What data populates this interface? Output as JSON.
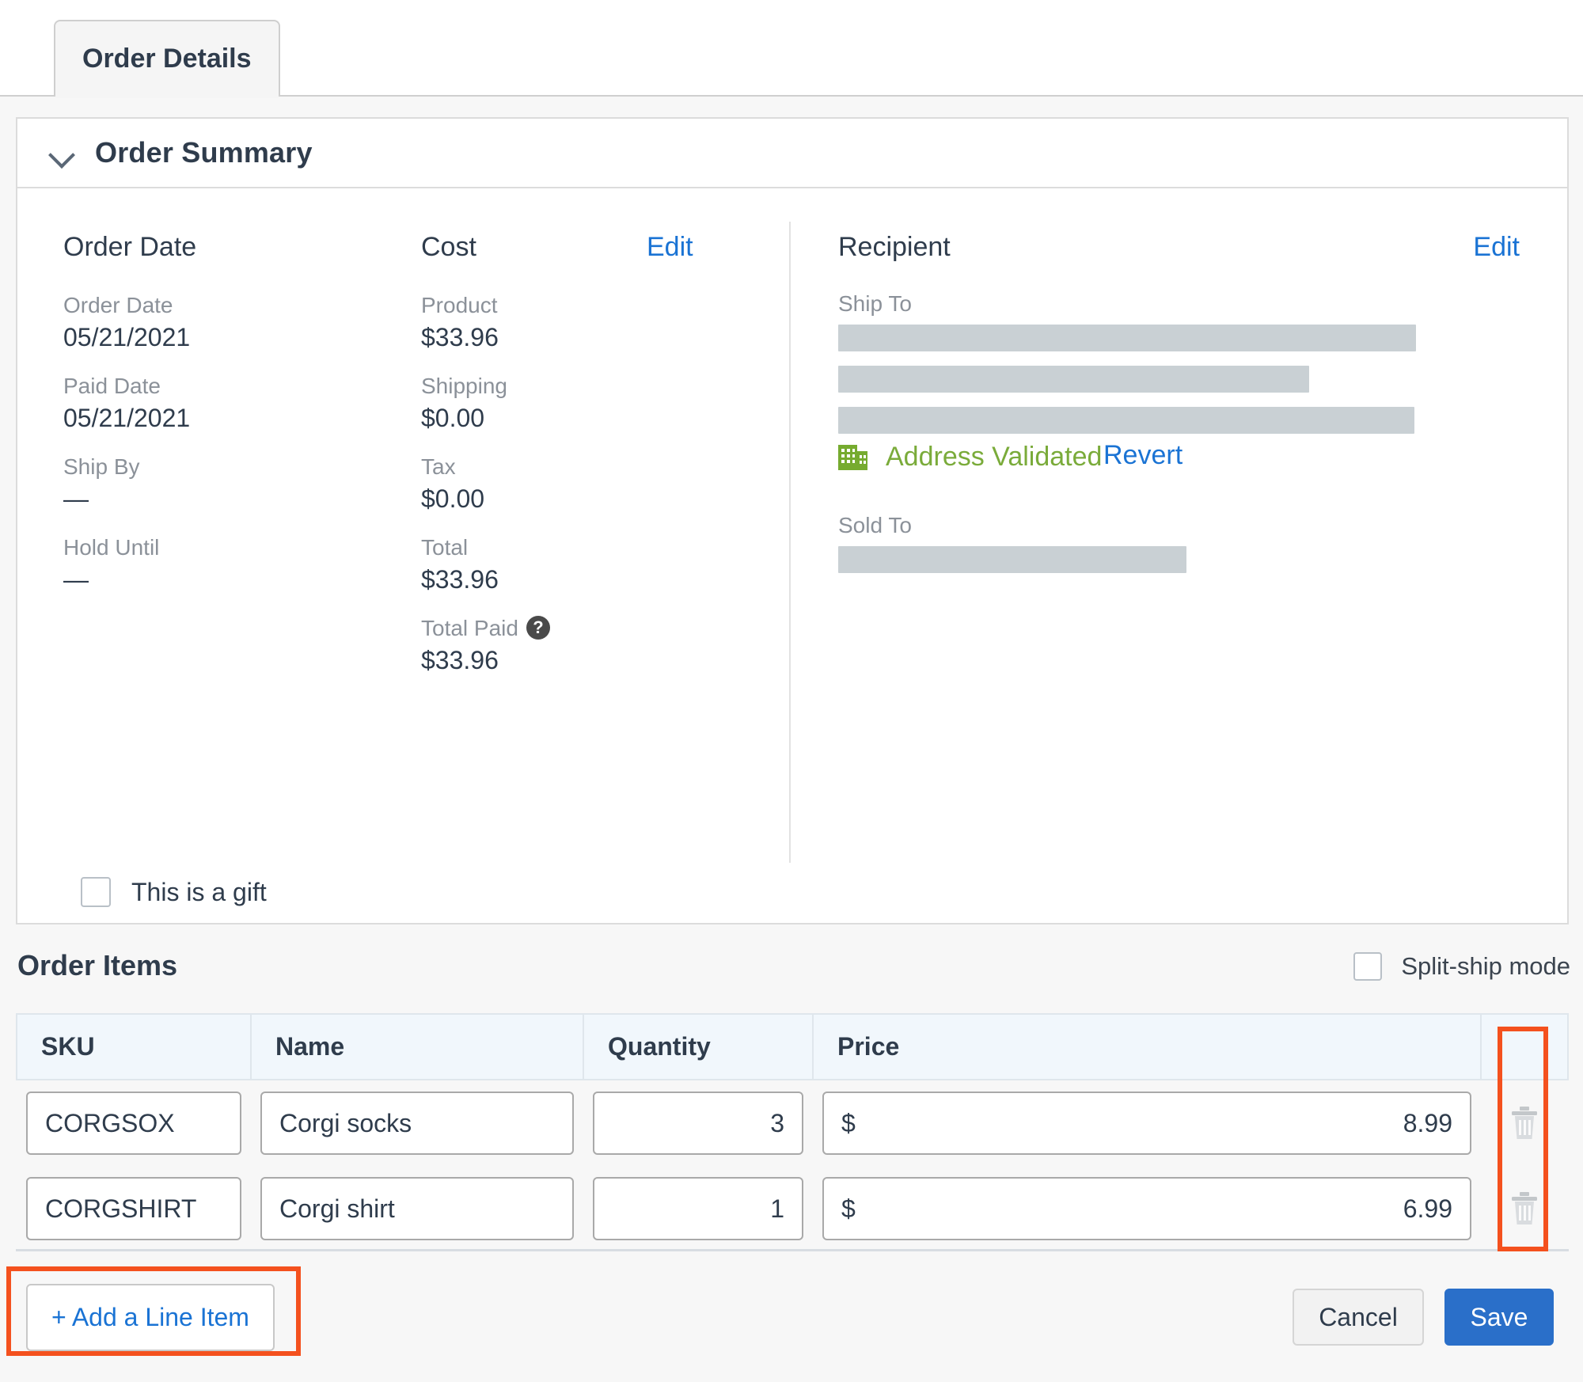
{
  "tab": {
    "label": "Order Details"
  },
  "summary": {
    "title": "Order Summary",
    "order_date": {
      "heading": "Order Date",
      "fields": [
        {
          "label": "Order Date",
          "value": "05/21/2021"
        },
        {
          "label": "Paid Date",
          "value": "05/21/2021"
        },
        {
          "label": "Ship By",
          "value": "—"
        },
        {
          "label": "Hold Until",
          "value": "—"
        }
      ]
    },
    "cost": {
      "heading": "Cost",
      "edit_label": "Edit",
      "fields": [
        {
          "label": "Product",
          "value": "$33.96"
        },
        {
          "label": "Shipping",
          "value": "$0.00"
        },
        {
          "label": "Tax",
          "value": "$0.00"
        },
        {
          "label": "Total",
          "value": "$33.96"
        },
        {
          "label": "Total Paid",
          "value": "$33.96",
          "help": "?"
        }
      ]
    },
    "recipient": {
      "heading": "Recipient",
      "edit_label": "Edit",
      "ship_to_label": "Ship To",
      "ship_to_lines": [
        "redacted",
        "redacted",
        "redacted"
      ],
      "address_validated_label": "Address Validated",
      "revert_label": "Revert",
      "sold_to_label": "Sold To",
      "sold_to_lines": [
        "redacted"
      ]
    },
    "gift_checkbox": {
      "label": "This is a gift",
      "checked": false
    }
  },
  "order_items": {
    "title": "Order Items",
    "split_ship": {
      "label": "Split-ship mode",
      "checked": false
    },
    "columns": [
      "SKU",
      "Name",
      "Quantity",
      "Price"
    ],
    "currency_symbol": "$",
    "rows": [
      {
        "sku": "CORGSOX",
        "name": "Corgi socks",
        "quantity": "3",
        "price": "8.99"
      },
      {
        "sku": "CORGSHIRT",
        "name": "Corgi shirt",
        "quantity": "1",
        "price": "6.99"
      }
    ],
    "delete_icon": "trash-icon"
  },
  "footer": {
    "add_line_item": "+ Add a Line Item",
    "cancel": "Cancel",
    "save": "Save"
  },
  "colors": {
    "link": "#1a73d4",
    "save_button": "#2a6fc9",
    "validated_green": "#7aab3a",
    "highlight_orange": "#f4511e",
    "redaction_gray": "#c9d0d4"
  }
}
